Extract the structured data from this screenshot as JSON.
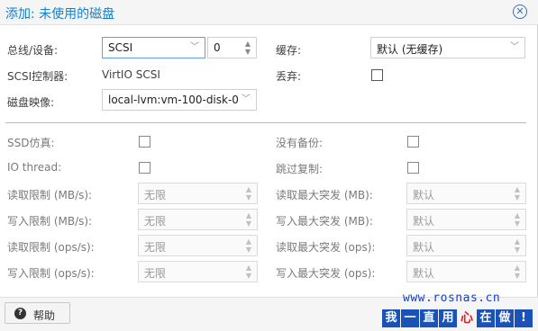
{
  "dialog": {
    "title": "添加: 未使用的磁盘"
  },
  "left_top": {
    "bus_label": "总线/设备:",
    "bus_value": "SCSI",
    "device_value": "0",
    "controller_label": "SCSI控制器:",
    "controller_value": "VirtIO SCSI",
    "image_label": "磁盘映像:",
    "image_value": "local-lvm:vm-100-disk-0"
  },
  "right_top": {
    "cache_label": "缓存:",
    "cache_value": "默认 (无缓存)",
    "discard_label": "丢弃:",
    "discard_checked": false
  },
  "advanced": {
    "ssd_label": "SSD仿真:",
    "iothread_label": "IO thread:",
    "read_limit_mbs_label": "读取限制 (MB/s):",
    "write_limit_mbs_label": "写入限制 (MB/s):",
    "read_limit_ops_label": "读取限制 (ops/s):",
    "write_limit_ops_label": "写入限制 (ops/s):",
    "limit_placeholder": "无限",
    "backup_label": "没有备份:",
    "replication_label": "跳过复制:",
    "read_burst_mb_label": "读取最大突发 (MB):",
    "write_burst_mb_label": "写入最大突发 (MB):",
    "read_burst_ops_label": "读取最大突发 (ops):",
    "write_burst_ops_label": "写入最大突发 (ops):",
    "burst_placeholder": "默认"
  },
  "footer": {
    "help_label": "帮助"
  },
  "watermark": {
    "url": "www.rosnas.cn",
    "chars": [
      "我",
      "一",
      "直",
      "用",
      "心",
      "在",
      "做",
      "!"
    ]
  },
  "colors": {
    "title": "#157fcc",
    "watermark_blue": "#1a52b8",
    "watermark_red": "#e21a2a"
  }
}
